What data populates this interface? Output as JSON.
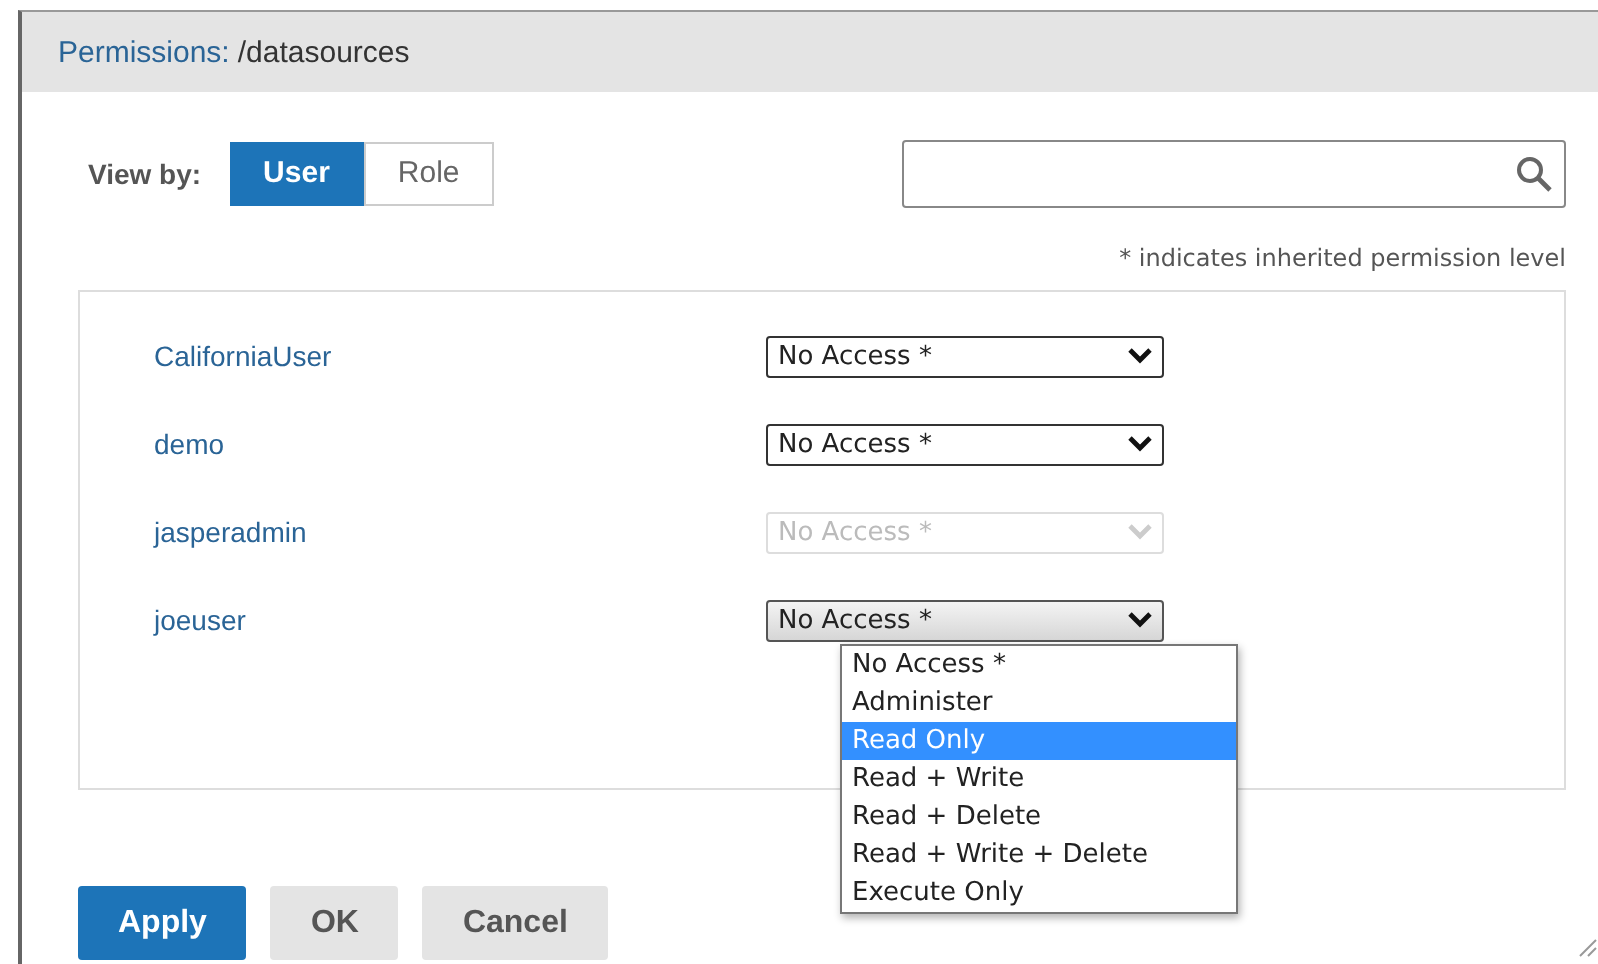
{
  "dialog": {
    "title_label": "Permissions:",
    "title_path": "/datasources"
  },
  "view_by": {
    "label": "View by:",
    "options": [
      {
        "label": "User",
        "selected": true
      },
      {
        "label": "Role",
        "selected": false
      }
    ]
  },
  "hint": "* indicates inherited permission level",
  "users": [
    {
      "name": "CaliforniaUser",
      "permission": "No Access *",
      "disabled": false,
      "expanded": false
    },
    {
      "name": "demo",
      "permission": "No Access *",
      "disabled": false,
      "expanded": false
    },
    {
      "name": "jasperadmin",
      "permission": "No Access *",
      "disabled": true,
      "expanded": false
    },
    {
      "name": "joeuser",
      "permission": "No Access *",
      "disabled": false,
      "expanded": true
    }
  ],
  "dropdown_options": [
    {
      "label": "No Access *",
      "selected": false
    },
    {
      "label": "Administer",
      "selected": false
    },
    {
      "label": "Read Only",
      "selected": true
    },
    {
      "label": "Read + Write",
      "selected": false
    },
    {
      "label": "Read + Delete",
      "selected": false
    },
    {
      "label": "Read + Write + Delete",
      "selected": false
    },
    {
      "label": "Execute Only",
      "selected": false
    }
  ],
  "buttons": [
    {
      "label": "Apply",
      "kind": "primary"
    },
    {
      "label": "OK",
      "kind": "secondary"
    },
    {
      "label": "Cancel",
      "kind": "secondary"
    }
  ]
}
